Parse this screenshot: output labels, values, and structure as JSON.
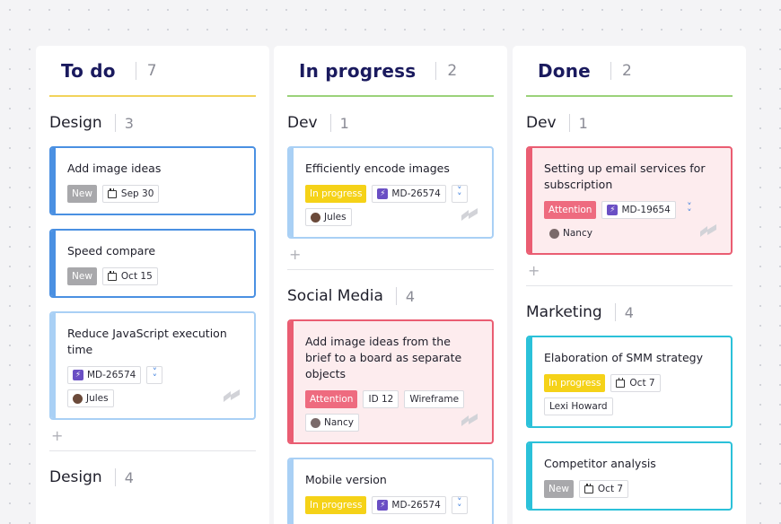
{
  "columns": [
    {
      "title": "To do",
      "count": "7",
      "groups": [
        {
          "title": "Design",
          "count": "3",
          "cards": [
            {
              "title": "Add image ideas",
              "status": "New",
              "date": "Sep 30"
            },
            {
              "title": "Speed compare",
              "status": "New",
              "date": "Oct 15"
            },
            {
              "title": "Reduce JavaScript execution time",
              "ticket": "MD-26574",
              "assignee": "Jules"
            }
          ]
        },
        {
          "title": "Design",
          "count": "4"
        }
      ]
    },
    {
      "title": "In progress",
      "count": "2",
      "groups": [
        {
          "title": "Dev",
          "count": "1",
          "cards": [
            {
              "title": "Efficiently encode images",
              "status": "In progress",
              "ticket": "MD-26574",
              "assignee": "Jules"
            }
          ]
        },
        {
          "title": "Social Media",
          "count": "4",
          "cards": [
            {
              "title": "Add image ideas from the brief to a board as separate objects",
              "status": "Attention",
              "tag1": "ID 12",
              "tag2": "Wireframe",
              "assignee": "Nancy"
            },
            {
              "title": "Mobile version",
              "status": "In progress",
              "ticket": "MD-26574"
            }
          ]
        }
      ]
    },
    {
      "title": "Done",
      "count": "2",
      "groups": [
        {
          "title": "Dev",
          "count": "1",
          "cards": [
            {
              "title": "Setting up email services for subscription",
              "status": "Attention",
              "ticket": "MD-19654",
              "assignee": "Nancy"
            }
          ]
        },
        {
          "title": "Marketing",
          "count": "4",
          "cards": [
            {
              "title": "Elaboration of SMM strategy",
              "status": "In progress",
              "date": "Oct 7",
              "assignee": "Lexi Howard"
            },
            {
              "title": "Competitor analysis",
              "status": "New",
              "date": "Oct 7"
            }
          ]
        }
      ]
    }
  ],
  "add_symbol": "+",
  "colors": {
    "todo_line": "#f2d35a",
    "progress_line": "#9bd27a",
    "done_line": "#9bd27a",
    "accent_title": "#1a1a5e"
  }
}
